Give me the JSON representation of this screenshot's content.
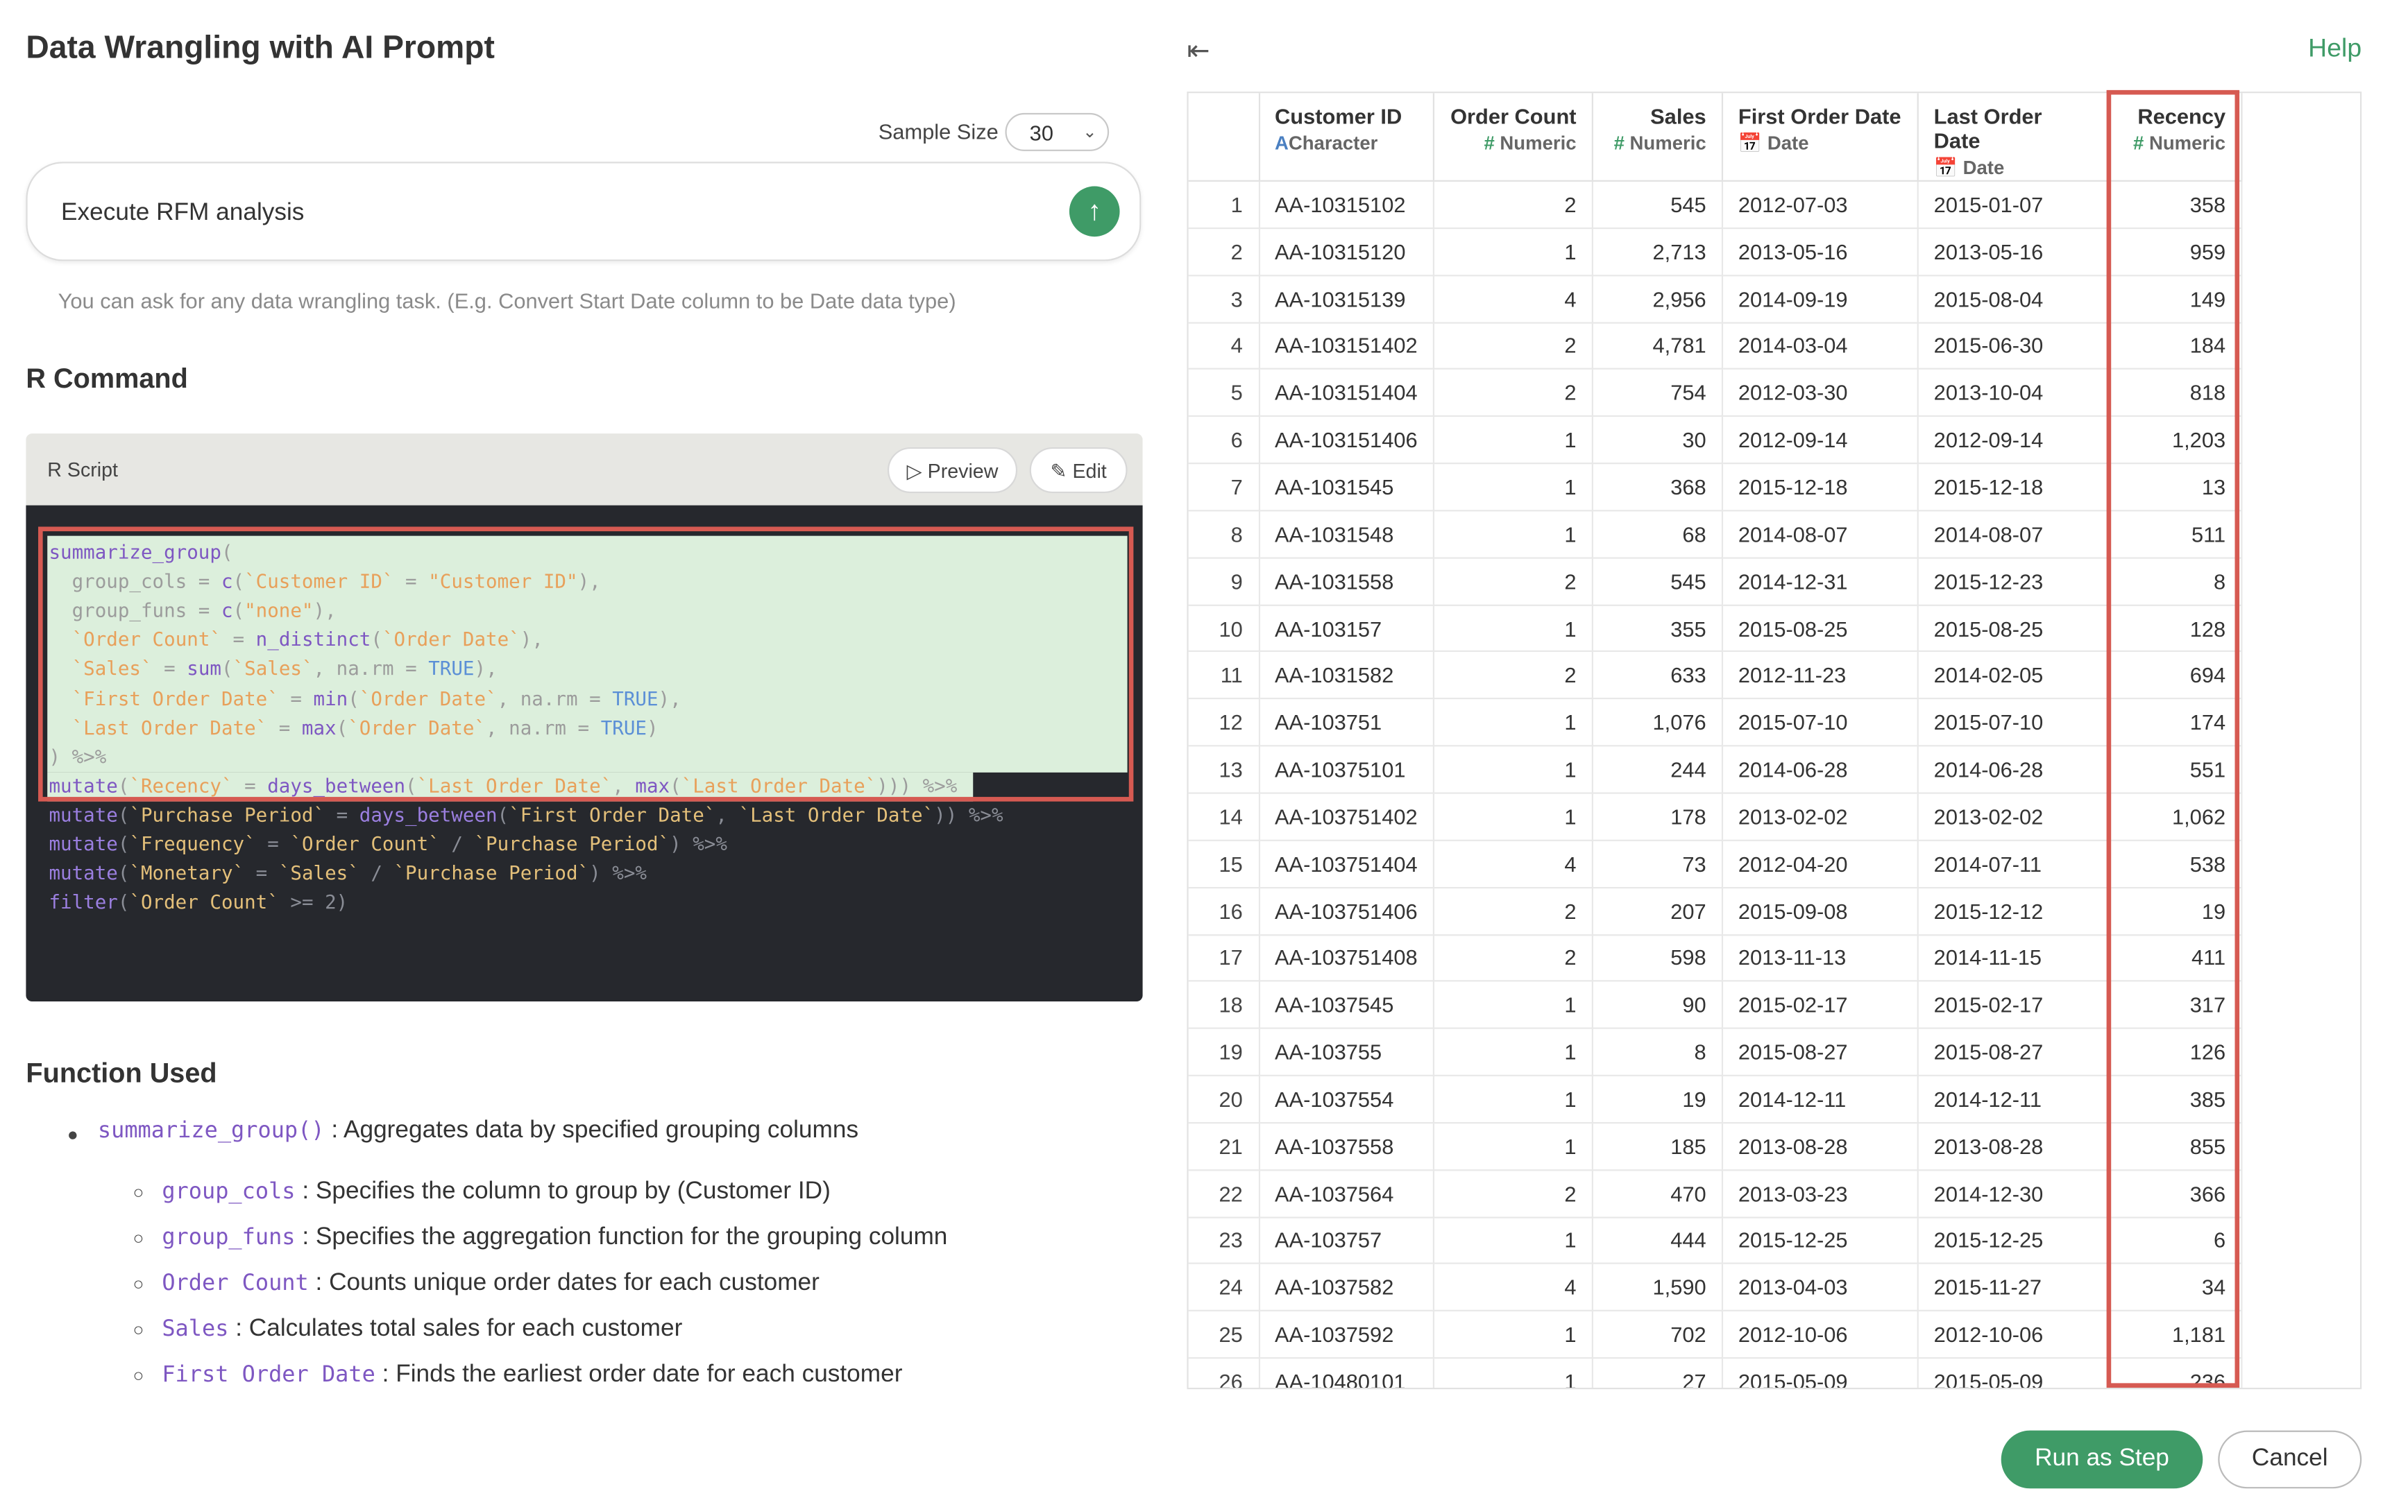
{
  "page_title": "Data Wrangling with AI Prompt",
  "sample_size": {
    "label": "Sample Size",
    "value": "30"
  },
  "prompt": {
    "text": "Execute RFM analysis",
    "send_icon": "arrow-up-icon"
  },
  "hint": "You can ask for any data wrangling task. (E.g. Convert Start Date column to be Date data type)",
  "r_command_heading": "R Command",
  "script": {
    "label": "R Script",
    "preview_label": "Preview",
    "edit_label": "Edit",
    "lines": [
      "summarize_group(",
      "  group_cols = c(`Customer ID` = \"Customer ID\"),",
      "  group_funs = c(\"none\"),",
      "  `Order Count` = n_distinct(`Order Date`),",
      "  `Sales` = sum(`Sales`, na.rm = TRUE),",
      "  `First Order Date` = min(`Order Date`, na.rm = TRUE),",
      "  `Last Order Date` = max(`Order Date`, na.rm = TRUE)",
      ") %>%",
      "mutate(`Recency` = days_between(`Last Order Date`, max(`Last Order Date`))) %>%",
      "mutate(`Purchase Period` = days_between(`First Order Date`, `Last Order Date`)) %>%",
      "mutate(`Frequency` = `Order Count` / `Purchase Period`) %>%",
      "mutate(`Monetary` = `Sales` / `Purchase Period`) %>%",
      "filter(`Order Count` >= 2)"
    ]
  },
  "function_used": {
    "heading": "Function Used",
    "main": {
      "code": "summarize_group()",
      "desc": ": Aggregates data by specified grouping columns"
    },
    "subs": [
      {
        "code": "group_cols",
        "desc": ": Specifies the column to group by (Customer ID)"
      },
      {
        "code": "group_funs",
        "desc": ": Specifies the aggregation function for the grouping column"
      },
      {
        "code": "Order Count",
        "desc": ": Counts unique order dates for each customer"
      },
      {
        "code": "Sales",
        "desc": ": Calculates total sales for each customer"
      },
      {
        "code": "First Order Date",
        "desc": ": Finds the earliest order date for each customer"
      }
    ]
  },
  "help_label": "Help",
  "table": {
    "columns": [
      {
        "name": "Customer ID",
        "type": "Character",
        "icon": "A"
      },
      {
        "name": "Order Count",
        "type": "Numeric",
        "icon": "#"
      },
      {
        "name": "Sales",
        "type": "Numeric",
        "icon": "#"
      },
      {
        "name": "First Order Date",
        "type": "Date",
        "icon": "calendar-icon"
      },
      {
        "name": "Last Order Date",
        "type": "Date",
        "icon": "calendar-icon"
      },
      {
        "name": "Recency",
        "type": "Numeric",
        "icon": "#"
      }
    ],
    "rows": [
      [
        "1",
        "AA-10315102",
        "2",
        "545",
        "2012-07-03",
        "2015-01-07",
        "358"
      ],
      [
        "2",
        "AA-10315120",
        "1",
        "2,713",
        "2013-05-16",
        "2013-05-16",
        "959"
      ],
      [
        "3",
        "AA-10315139",
        "4",
        "2,956",
        "2014-09-19",
        "2015-08-04",
        "149"
      ],
      [
        "4",
        "AA-103151402",
        "2",
        "4,781",
        "2014-03-04",
        "2015-06-30",
        "184"
      ],
      [
        "5",
        "AA-103151404",
        "2",
        "754",
        "2012-03-30",
        "2013-10-04",
        "818"
      ],
      [
        "6",
        "AA-103151406",
        "1",
        "30",
        "2012-09-14",
        "2012-09-14",
        "1,203"
      ],
      [
        "7",
        "AA-1031545",
        "1",
        "368",
        "2015-12-18",
        "2015-12-18",
        "13"
      ],
      [
        "8",
        "AA-1031548",
        "1",
        "68",
        "2014-08-07",
        "2014-08-07",
        "511"
      ],
      [
        "9",
        "AA-1031558",
        "2",
        "545",
        "2014-12-31",
        "2015-12-23",
        "8"
      ],
      [
        "10",
        "AA-103157",
        "1",
        "355",
        "2015-08-25",
        "2015-08-25",
        "128"
      ],
      [
        "11",
        "AA-1031582",
        "2",
        "633",
        "2012-11-23",
        "2014-02-05",
        "694"
      ],
      [
        "12",
        "AA-103751",
        "1",
        "1,076",
        "2015-07-10",
        "2015-07-10",
        "174"
      ],
      [
        "13",
        "AA-10375101",
        "1",
        "244",
        "2014-06-28",
        "2014-06-28",
        "551"
      ],
      [
        "14",
        "AA-103751402",
        "1",
        "178",
        "2013-02-02",
        "2013-02-02",
        "1,062"
      ],
      [
        "15",
        "AA-103751404",
        "4",
        "73",
        "2012-04-20",
        "2014-07-11",
        "538"
      ],
      [
        "16",
        "AA-103751406",
        "2",
        "207",
        "2015-09-08",
        "2015-12-12",
        "19"
      ],
      [
        "17",
        "AA-103751408",
        "2",
        "598",
        "2013-11-13",
        "2014-11-15",
        "411"
      ],
      [
        "18",
        "AA-1037545",
        "1",
        "90",
        "2015-02-17",
        "2015-02-17",
        "317"
      ],
      [
        "19",
        "AA-103755",
        "1",
        "8",
        "2015-08-27",
        "2015-08-27",
        "126"
      ],
      [
        "20",
        "AA-1037554",
        "1",
        "19",
        "2014-12-11",
        "2014-12-11",
        "385"
      ],
      [
        "21",
        "AA-1037558",
        "1",
        "185",
        "2013-08-28",
        "2013-08-28",
        "855"
      ],
      [
        "22",
        "AA-1037564",
        "2",
        "470",
        "2013-03-23",
        "2014-12-30",
        "366"
      ],
      [
        "23",
        "AA-103757",
        "1",
        "444",
        "2015-12-25",
        "2015-12-25",
        "6"
      ],
      [
        "24",
        "AA-1037582",
        "4",
        "1,590",
        "2013-04-03",
        "2015-11-27",
        "34"
      ],
      [
        "25",
        "AA-1037592",
        "1",
        "702",
        "2012-10-06",
        "2012-10-06",
        "1,181"
      ],
      [
        "26",
        "AA-10480101",
        "1",
        "27",
        "2015-05-09",
        "2015-05-09",
        "236"
      ]
    ]
  },
  "buttons": {
    "run_label": "Run as Step",
    "cancel_label": "Cancel"
  }
}
